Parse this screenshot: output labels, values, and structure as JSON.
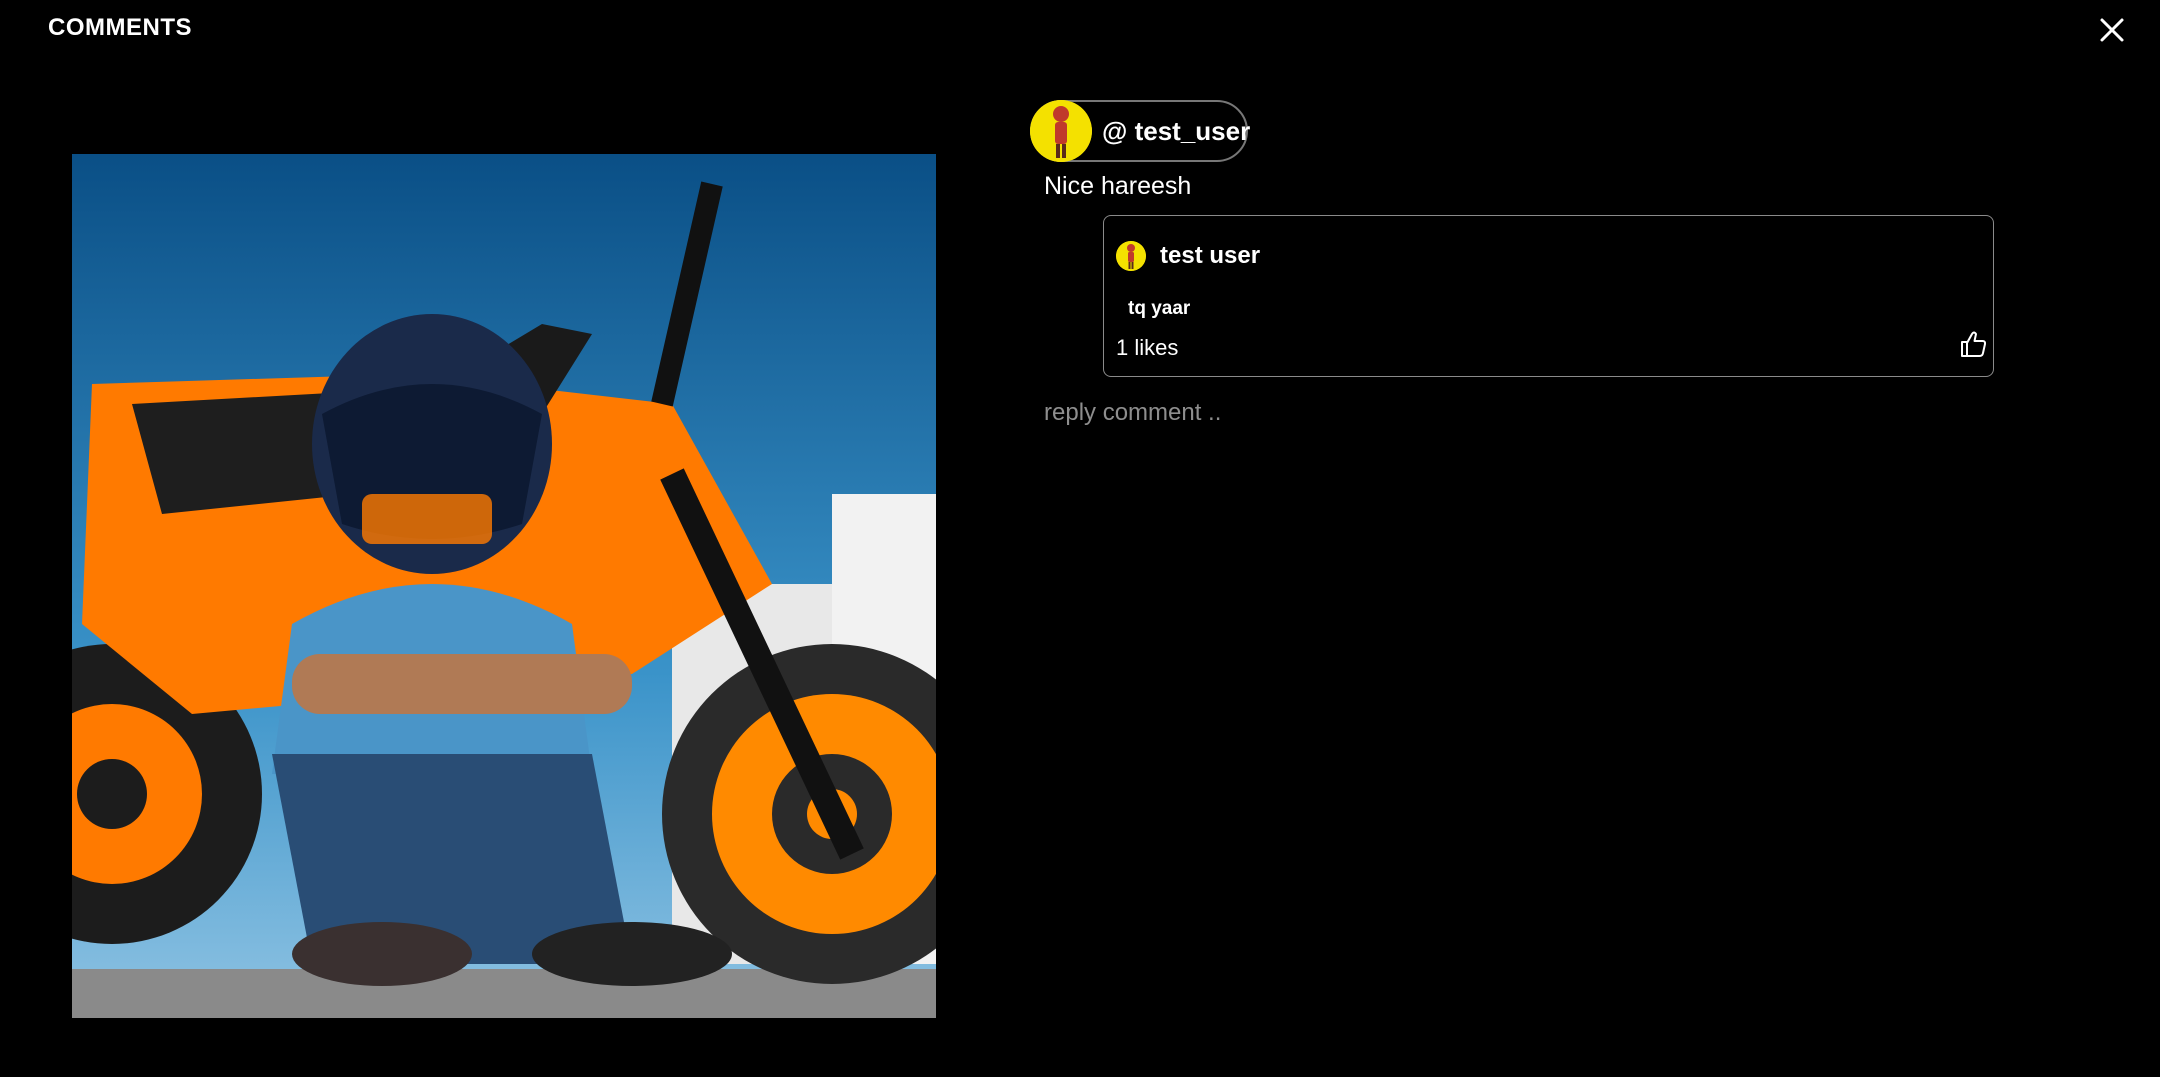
{
  "header": {
    "title": "COMMENTS",
    "close_icon": "close-icon"
  },
  "post": {
    "image_alt": "Rider in helmet sitting in front of an orange motorcycle"
  },
  "comment": {
    "handle": "@ test_user",
    "text": "Nice hareesh",
    "avatar_icon": "user-avatar"
  },
  "reply": {
    "user": "test user",
    "text": "tq yaar",
    "likes": "1 likes",
    "like_icon": "thumbs-up-icon"
  },
  "reply_input": {
    "placeholder": "reply comment .."
  },
  "colors": {
    "background": "#000000",
    "avatar_bg": "#f4e100",
    "border": "#8a8a8a",
    "accent": "#ff8a00"
  }
}
